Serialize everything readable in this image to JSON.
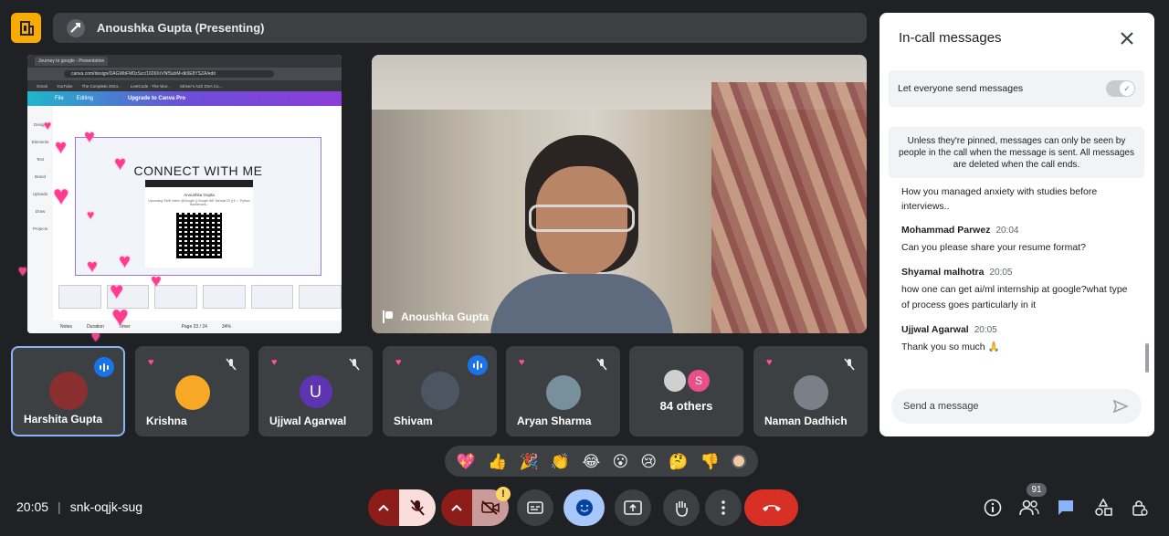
{
  "presenting": {
    "label": "Anoushka Gupta (Presenting)"
  },
  "shared_screen": {
    "browser_tab": "Journey to google - Presentation",
    "url": "canva.com/design/DAGWbFM0zSzc/1609XrVNfSsbM-dk9E8YSZA/edit",
    "bookmarks": [
      "Gmail",
      "YouTube",
      "The Complete 2024...",
      "LeetCode - The Wor...",
      "Striver's A2Z DSA Co..."
    ],
    "toolbar": {
      "file": "File",
      "editing": "Editing",
      "upgrade": "Upgrade to Canva Pro"
    },
    "side_items": [
      "Design",
      "Elements",
      "Text",
      "Brand",
      "Uploads",
      "Draw",
      "Projects"
    ],
    "slide_title": "CONNECT WITH ME",
    "card_name": "Anoushka Gupta",
    "card_sub": "Upcoming SWE Intern @Google || Google WE Scholar'23 || 6 ☆ Python Hackerrank...",
    "footer": {
      "notes": "Notes",
      "duration": "Duration",
      "timer": "Timer",
      "page": "Page 23 / 24",
      "zoom": "34%"
    }
  },
  "main_video": {
    "name": "Anoushka Gupta"
  },
  "participants": [
    {
      "name": "Harshita Gupta",
      "active": true,
      "speaking": true,
      "color": "#5f6368",
      "initial": ""
    },
    {
      "name": "Krishna",
      "active": false,
      "speaking": false,
      "color": "#f9a825",
      "initial": ""
    },
    {
      "name": "Ujjwal Agarwal",
      "active": false,
      "speaking": false,
      "color": "#5e35b1",
      "initial": "U"
    },
    {
      "name": "Shivam",
      "active": false,
      "speaking": true,
      "color": "#4d5563",
      "initial": ""
    },
    {
      "name": "Aryan Sharma",
      "active": false,
      "speaking": false,
      "color": "#78909c",
      "initial": ""
    },
    {
      "name": "84 others",
      "active": false,
      "speaking": false,
      "color": "#e8508a",
      "initial": "S"
    },
    {
      "name": "Naman Dadhich",
      "active": false,
      "speaking": false,
      "color": "#7a8088",
      "initial": ""
    }
  ],
  "chat": {
    "title": "In-call messages",
    "toggle_label": "Let everyone send messages",
    "notice": "Unless they're pinned, messages can only be seen by people in the call when the message is sent. All messages are deleted when the call ends.",
    "cut_message": "How you managed anxiety with studies before interviews..",
    "messages": [
      {
        "sender": "Mohammad Parwez",
        "time": "20:04",
        "text": "Can you please share your resume format?"
      },
      {
        "sender": "Shyamal malhotra",
        "time": "20:05",
        "text": "how one can  get ai/ml internship at google?what type  of process goes particularly in it"
      },
      {
        "sender": "Ujjwal Agarwal",
        "time": "20:05",
        "text": "Thank you so much 🙏"
      }
    ],
    "input_placeholder": "Send a message"
  },
  "reactions": [
    "💖",
    "👍",
    "🎉",
    "👏",
    "😂",
    "😮",
    "😢",
    "🤔",
    "👎"
  ],
  "meeting": {
    "time": "20:05",
    "code": "snk-oqjk-sug"
  },
  "people_count": "91",
  "colors": {
    "accent": "#8ab4f8",
    "leave": "#d93025",
    "mic_off_bg": "#f9dedc",
    "active_reaction": "#a8c7fa"
  }
}
